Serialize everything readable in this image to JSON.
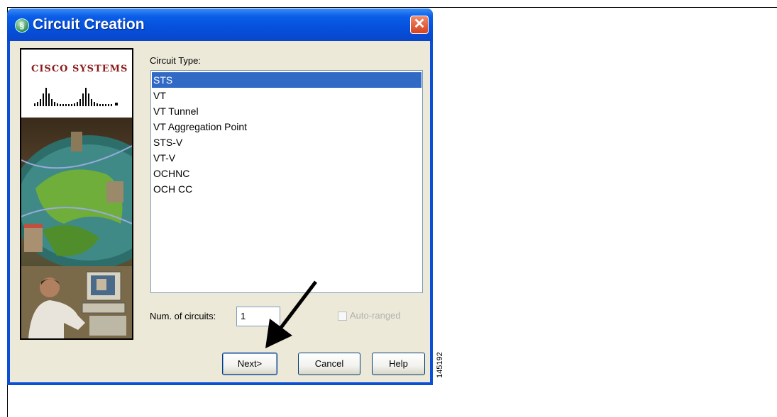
{
  "dialog": {
    "title": "Circuit Creation",
    "close_label": "✕",
    "title_icon_glyph": "§"
  },
  "banner": {
    "logo_text": "CISCO SYSTEMS"
  },
  "circuit_type": {
    "label": "Circuit Type:",
    "items": [
      "STS",
      "VT",
      "VT Tunnel",
      "VT Aggregation Point",
      "STS-V",
      "VT-V",
      "OCHNC",
      "OCH CC"
    ],
    "selected": "STS"
  },
  "num_circuits": {
    "label": "Num. of circuits:",
    "value": "1"
  },
  "auto_ranged": {
    "label": "Auto-ranged",
    "checked": false,
    "enabled": false
  },
  "buttons": {
    "next": "Next>",
    "cancel": "Cancel",
    "help": "Help"
  },
  "figure_id": "145192",
  "colors": {
    "titlebar": "#0550dc",
    "selection": "#316ac5",
    "dialog_bg": "#ece9d8",
    "logo_red": "#8b1a1a"
  }
}
